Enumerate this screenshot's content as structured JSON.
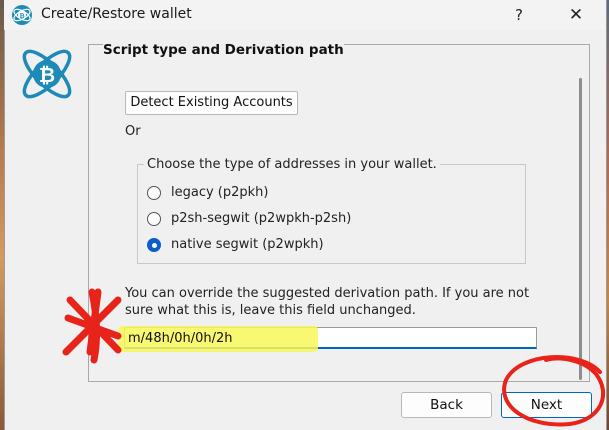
{
  "window": {
    "title": "Create/Restore wallet",
    "help_label": "?",
    "close_label": "✕",
    "accent": "#0067c0"
  },
  "section": {
    "title": "Script type and Derivation path",
    "detect_button": "Detect Existing Accounts",
    "or_text": "Or"
  },
  "address_types": {
    "title": "Choose the type of addresses in your wallet.",
    "options": [
      {
        "label": "legacy (p2pkh)",
        "checked": false
      },
      {
        "label": "p2sh-segwit (p2wpkh-p2sh)",
        "checked": false
      },
      {
        "label": "native segwit (p2wpkh)",
        "checked": true
      }
    ]
  },
  "derivation": {
    "help_text": "You can override the suggested derivation path. If you are not sure what this is, leave this field unchanged.",
    "value": "m/48h/0h/0h/2h",
    "highlight_color": "#f7f75a"
  },
  "footer": {
    "back_label": "Back",
    "next_label": "Next"
  },
  "annotations": {
    "marker_color": "#e8231a"
  }
}
